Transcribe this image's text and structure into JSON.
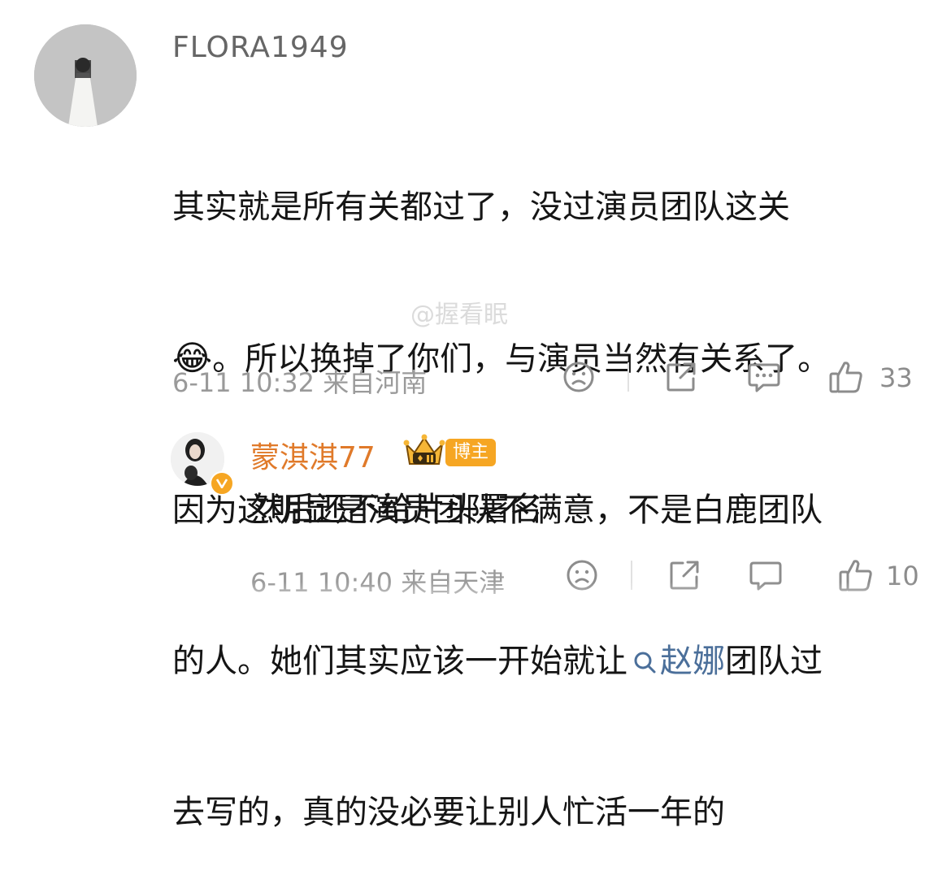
{
  "comment": {
    "username": "FLORA1949",
    "text_lines": [
      "其实就是所有关都过了，没过演员团队这关",
      "。所以换掉了你们，与演员当然有关系了。",
      "因为这明显是演员团队不满意，不是白鹿团队",
      "的人。她们其实应该一开始就让",
      "去写的，真的没必要让别人忙活一年的"
    ],
    "emoji": "😂",
    "mention": "赵娜",
    "line4_after": "团队过",
    "meta": "6-11 10:32  来自河南",
    "like_count": "33"
  },
  "reply": {
    "username": "蒙淇淇77",
    "badge": "博主",
    "text": "然后还不给片头署名",
    "meta": "6-11 10:40  来自天津",
    "like_count": "10"
  },
  "watermark": "@握看眠",
  "icons": {
    "dislike": "sad-face-icon",
    "share": "share-icon",
    "comment": "comment-bubble-icon",
    "like": "thumbs-up-icon",
    "search": "search-icon",
    "crown": "crown-icon",
    "verified": "verified-v-icon"
  },
  "colors": {
    "mention": "#4b6f9a",
    "reply_name": "#e07a2a",
    "badge": "#f6a623"
  }
}
